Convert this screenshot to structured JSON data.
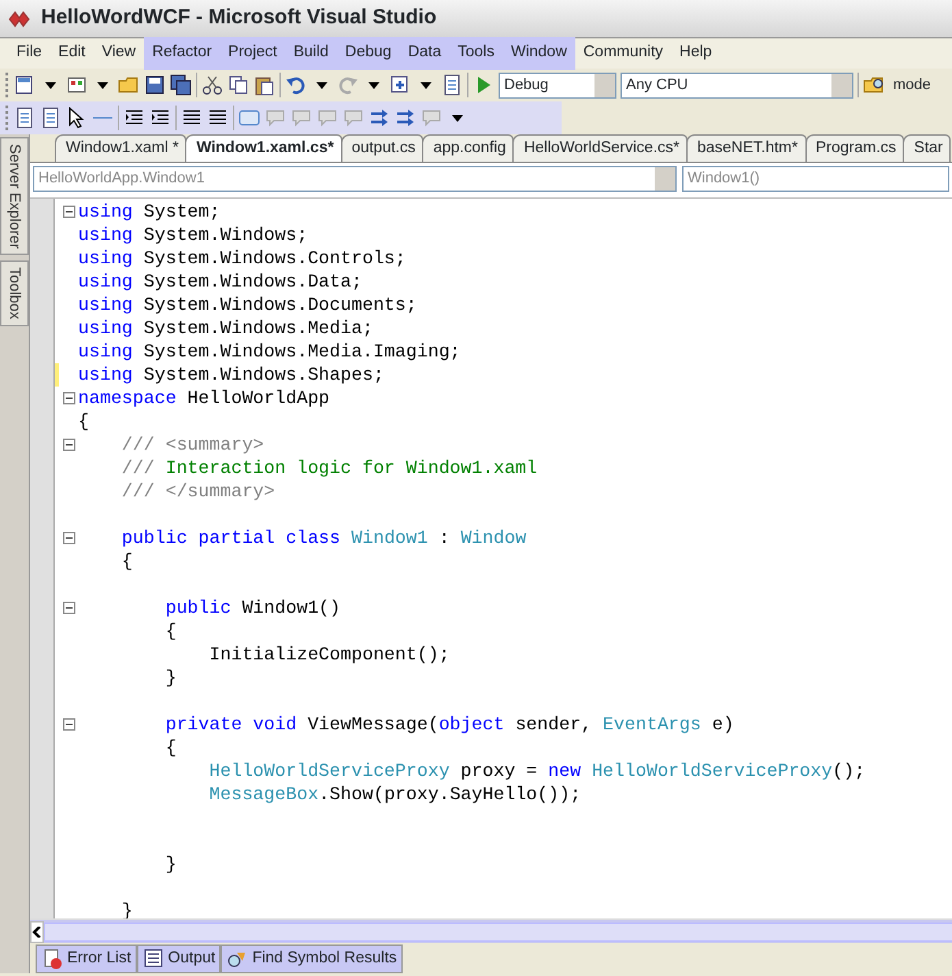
{
  "window": {
    "title": "HelloWordWCF - Microsoft Visual Studio"
  },
  "menu": [
    "File",
    "Edit",
    "View",
    "Refactor",
    "Project",
    "Build",
    "Debug",
    "Data",
    "Tools",
    "Window",
    "Community",
    "Help"
  ],
  "toolbar": {
    "configuration": "Debug",
    "platform": "Any CPU",
    "find_text": "mode"
  },
  "side_tabs": [
    "Server Explorer",
    "Toolbox"
  ],
  "tabs": [
    {
      "label": "Window1.xaml *",
      "selected": false
    },
    {
      "label": "Window1.xaml.cs*",
      "selected": true
    },
    {
      "label": "output.cs",
      "selected": false
    },
    {
      "label": "app.config",
      "selected": false
    },
    {
      "label": "HelloWorldService.cs*",
      "selected": false
    },
    {
      "label": "baseNET.htm*",
      "selected": false
    },
    {
      "label": "Program.cs",
      "selected": false
    },
    {
      "label": "Star",
      "selected": false
    }
  ],
  "navigation": {
    "type_combo": "HelloWorldApp.Window1",
    "member_combo": "Window1()"
  },
  "code_lines": [
    {
      "fold": true,
      "changed": false,
      "tokens": [
        {
          "t": "using",
          "kind": "keyword"
        },
        {
          "t": " System;",
          "kind": "plain"
        }
      ]
    },
    {
      "fold": false,
      "changed": false,
      "tokens": [
        {
          "t": "using",
          "kind": "keyword"
        },
        {
          "t": " System.Windows;",
          "kind": "plain"
        }
      ]
    },
    {
      "fold": false,
      "changed": false,
      "tokens": [
        {
          "t": "using",
          "kind": "keyword"
        },
        {
          "t": " System.Windows.Controls;",
          "kind": "plain"
        }
      ]
    },
    {
      "fold": false,
      "changed": false,
      "tokens": [
        {
          "t": "using",
          "kind": "keyword"
        },
        {
          "t": " System.Windows.Data;",
          "kind": "plain"
        }
      ]
    },
    {
      "fold": false,
      "changed": false,
      "tokens": [
        {
          "t": "using",
          "kind": "keyword"
        },
        {
          "t": " System.Windows.Documents;",
          "kind": "plain"
        }
      ]
    },
    {
      "fold": false,
      "changed": false,
      "tokens": [
        {
          "t": "using",
          "kind": "keyword"
        },
        {
          "t": " System.Windows.Media;",
          "kind": "plain"
        }
      ]
    },
    {
      "fold": false,
      "changed": false,
      "tokens": [
        {
          "t": "using",
          "kind": "keyword"
        },
        {
          "t": " System.Windows.Media.Imaging;",
          "kind": "plain"
        }
      ]
    },
    {
      "fold": false,
      "changed": true,
      "tokens": [
        {
          "t": "using",
          "kind": "keyword"
        },
        {
          "t": " System.Windows.Shapes;",
          "kind": "plain"
        }
      ]
    },
    {
      "fold": true,
      "changed": false,
      "tokens": [
        {
          "t": "namespace",
          "kind": "keyword"
        },
        {
          "t": " HelloWorldApp",
          "kind": "plain"
        }
      ]
    },
    {
      "fold": false,
      "changed": false,
      "tokens": [
        {
          "t": "{",
          "kind": "plain"
        }
      ]
    },
    {
      "fold": true,
      "changed": false,
      "tokens": [
        {
          "t": "    /// <summary>",
          "kind": "doc"
        }
      ]
    },
    {
      "fold": false,
      "changed": false,
      "tokens": [
        {
          "t": "    /// ",
          "kind": "doc"
        },
        {
          "t": "Interaction logic for Window1.xaml",
          "kind": "comment"
        }
      ]
    },
    {
      "fold": false,
      "changed": false,
      "tokens": [
        {
          "t": "    /// </summary>",
          "kind": "doc"
        }
      ]
    },
    {
      "fold": false,
      "changed": false
    },
    {
      "fold": true,
      "changed": false,
      "tokens": [
        {
          "t": "    public partial class ",
          "kind": "keyword"
        },
        {
          "t": "Window1",
          "kind": "type"
        },
        {
          "t": " : ",
          "kind": "plain"
        },
        {
          "t": "Window",
          "kind": "type"
        }
      ]
    },
    {
      "fold": false,
      "changed": false,
      "tokens": [
        {
          "t": "    {",
          "kind": "plain"
        }
      ]
    },
    {
      "fold": false,
      "changed": false
    },
    {
      "fold": true,
      "changed": false,
      "tokens": [
        {
          "t": "        public",
          "kind": "keyword"
        },
        {
          "t": " Window1()",
          "kind": "plain"
        }
      ]
    },
    {
      "fold": false,
      "changed": false,
      "tokens": [
        {
          "t": "        {",
          "kind": "plain"
        }
      ]
    },
    {
      "fold": false,
      "changed": false,
      "tokens": [
        {
          "t": "            InitializeComponent();",
          "kind": "plain"
        }
      ]
    },
    {
      "fold": false,
      "changed": false,
      "tokens": [
        {
          "t": "        }",
          "kind": "plain"
        }
      ]
    },
    {
      "fold": false,
      "changed": false
    },
    {
      "fold": true,
      "changed": false,
      "tokens": [
        {
          "t": "        private void",
          "kind": "keyword"
        },
        {
          "t": " ViewMessage(",
          "kind": "plain"
        },
        {
          "t": "object",
          "kind": "keyword"
        },
        {
          "t": " sender, ",
          "kind": "plain"
        },
        {
          "t": "EventArgs",
          "kind": "type"
        },
        {
          "t": " e)",
          "kind": "plain"
        }
      ]
    },
    {
      "fold": false,
      "changed": false,
      "tokens": [
        {
          "t": "        {",
          "kind": "plain"
        }
      ]
    },
    {
      "fold": false,
      "changed": false,
      "tokens": [
        {
          "t": "            HelloWorldServiceProxy",
          "kind": "type"
        },
        {
          "t": " proxy = ",
          "kind": "plain"
        },
        {
          "t": "new ",
          "kind": "keyword"
        },
        {
          "t": "HelloWorldServiceProxy",
          "kind": "type"
        },
        {
          "t": "();",
          "kind": "plain"
        }
      ]
    },
    {
      "fold": false,
      "changed": false,
      "tokens": [
        {
          "t": "            MessageBox",
          "kind": "type"
        },
        {
          "t": ".Show(proxy.SayHello());",
          "kind": "plain"
        }
      ]
    },
    {
      "fold": false,
      "changed": false
    },
    {
      "fold": false,
      "changed": false
    },
    {
      "fold": false,
      "changed": false,
      "tokens": [
        {
          "t": "        }",
          "kind": "plain"
        }
      ]
    },
    {
      "fold": false,
      "changed": false
    },
    {
      "fold": false,
      "changed": false,
      "tokens": [
        {
          "t": "    }",
          "kind": "plain"
        }
      ]
    }
  ],
  "bottom_tabs": [
    {
      "label": "Error List",
      "selected": false
    },
    {
      "label": "Output",
      "selected": false
    },
    {
      "label": "Find Symbol Results",
      "selected": false
    }
  ]
}
